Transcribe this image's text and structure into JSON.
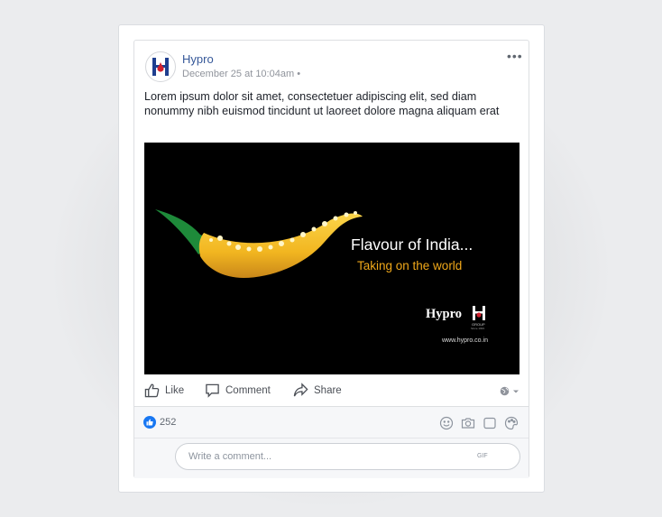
{
  "post": {
    "page_name": "Hypro",
    "timestamp": "December 25 at 10:04am",
    "meta_separator": "•",
    "more_label": "•••",
    "text": "Lorem ipsum dolor sit amet, consectetuer adipiscing elit, sed diam nonummy nibh euismod tincidunt ut laoreet dolore magna aliquam erat"
  },
  "image": {
    "headline": "Flavour of India...",
    "tagline": "Taking on the world",
    "brand": "Hypro",
    "brand_sub": "GROUP",
    "brand_since": "Since 1993",
    "url": "www.hypro.co.in",
    "colors": {
      "background": "#000000",
      "tagline": "#f0a81a",
      "chili": "#f2b620",
      "stem": "#1e8a3a"
    }
  },
  "actions": {
    "like": "Like",
    "comment": "Comment",
    "share": "Share"
  },
  "reactions": {
    "like_count": "252"
  },
  "comment": {
    "placeholder": "Write a comment...",
    "gif_label": "GIF"
  },
  "colors": {
    "link": "#365899",
    "like_blue": "#1877f2",
    "page_bg": "#ebecee"
  }
}
